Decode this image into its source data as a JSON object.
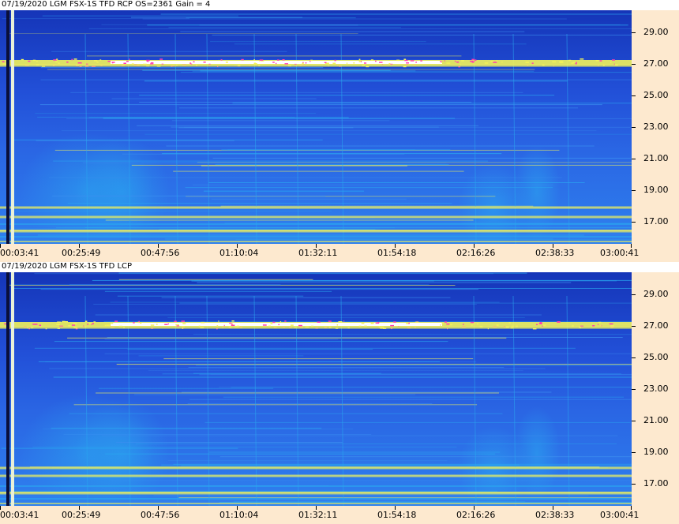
{
  "panels": [
    {
      "title": "07/19/2020  LGM FSX-1S TFD RCP   OS=2361 Gain = 4"
    },
    {
      "title": "07/19/2020  LGM FSX-1S TFD LCP"
    }
  ],
  "chart_data": [
    {
      "type": "heatmap",
      "title": "07/19/2020  LGM FSX-1S TFD RCP   OS=2361 Gain = 4",
      "x_tick_labels": [
        "00:03:41",
        "00:25:49",
        "00:47:56",
        "01:10:04",
        "01:32:11",
        "01:54:18",
        "02:16:26",
        "02:38:33",
        "03:00:41"
      ],
      "y_tick_labels": [
        "29.00",
        "27.00",
        "25.00",
        "23.00",
        "21.00",
        "19.00",
        "17.00"
      ],
      "y_ticks": [
        29,
        27,
        25,
        23,
        21,
        19,
        17
      ],
      "ylim": [
        15.6,
        30.4
      ],
      "bright_bands": [
        {
          "y": 27.1,
          "intensity": 1.0
        },
        {
          "y": 26.9,
          "intensity": 0.8
        },
        {
          "y": 17.9,
          "intensity": 0.55
        },
        {
          "y": 17.3,
          "intensity": 0.5
        },
        {
          "y": 16.4,
          "intensity": 0.45
        }
      ],
      "colors": {
        "low": "#1a3fd6",
        "mid": "#2aa8f0",
        "high": "#f2f25a",
        "peak": "#ffffff",
        "hot": "#ff3fb0"
      }
    },
    {
      "type": "heatmap",
      "title": "07/19/2020  LGM FSX-1S TFD LCP",
      "x_tick_labels": [
        "00:03:41",
        "00:25:49",
        "00:47:56",
        "01:10:04",
        "01:32:11",
        "01:54:18",
        "02:16:26",
        "02:38:33",
        "03:00:41"
      ],
      "y_tick_labels": [
        "29.00",
        "27.00",
        "25.00",
        "23.00",
        "21.00",
        "19.00",
        "17.00"
      ],
      "y_ticks": [
        29,
        27,
        25,
        23,
        21,
        19,
        17
      ],
      "ylim": [
        15.6,
        30.4
      ],
      "bright_bands": [
        {
          "y": 27.1,
          "intensity": 1.0
        },
        {
          "y": 26.9,
          "intensity": 0.8
        },
        {
          "y": 18.0,
          "intensity": 0.55
        },
        {
          "y": 17.5,
          "intensity": 0.5
        },
        {
          "y": 16.4,
          "intensity": 0.45
        }
      ],
      "colors": {
        "low": "#1a3fd6",
        "mid": "#2aa8f0",
        "high": "#f2f25a",
        "peak": "#ffffff",
        "hot": "#ff3fb0"
      }
    }
  ]
}
